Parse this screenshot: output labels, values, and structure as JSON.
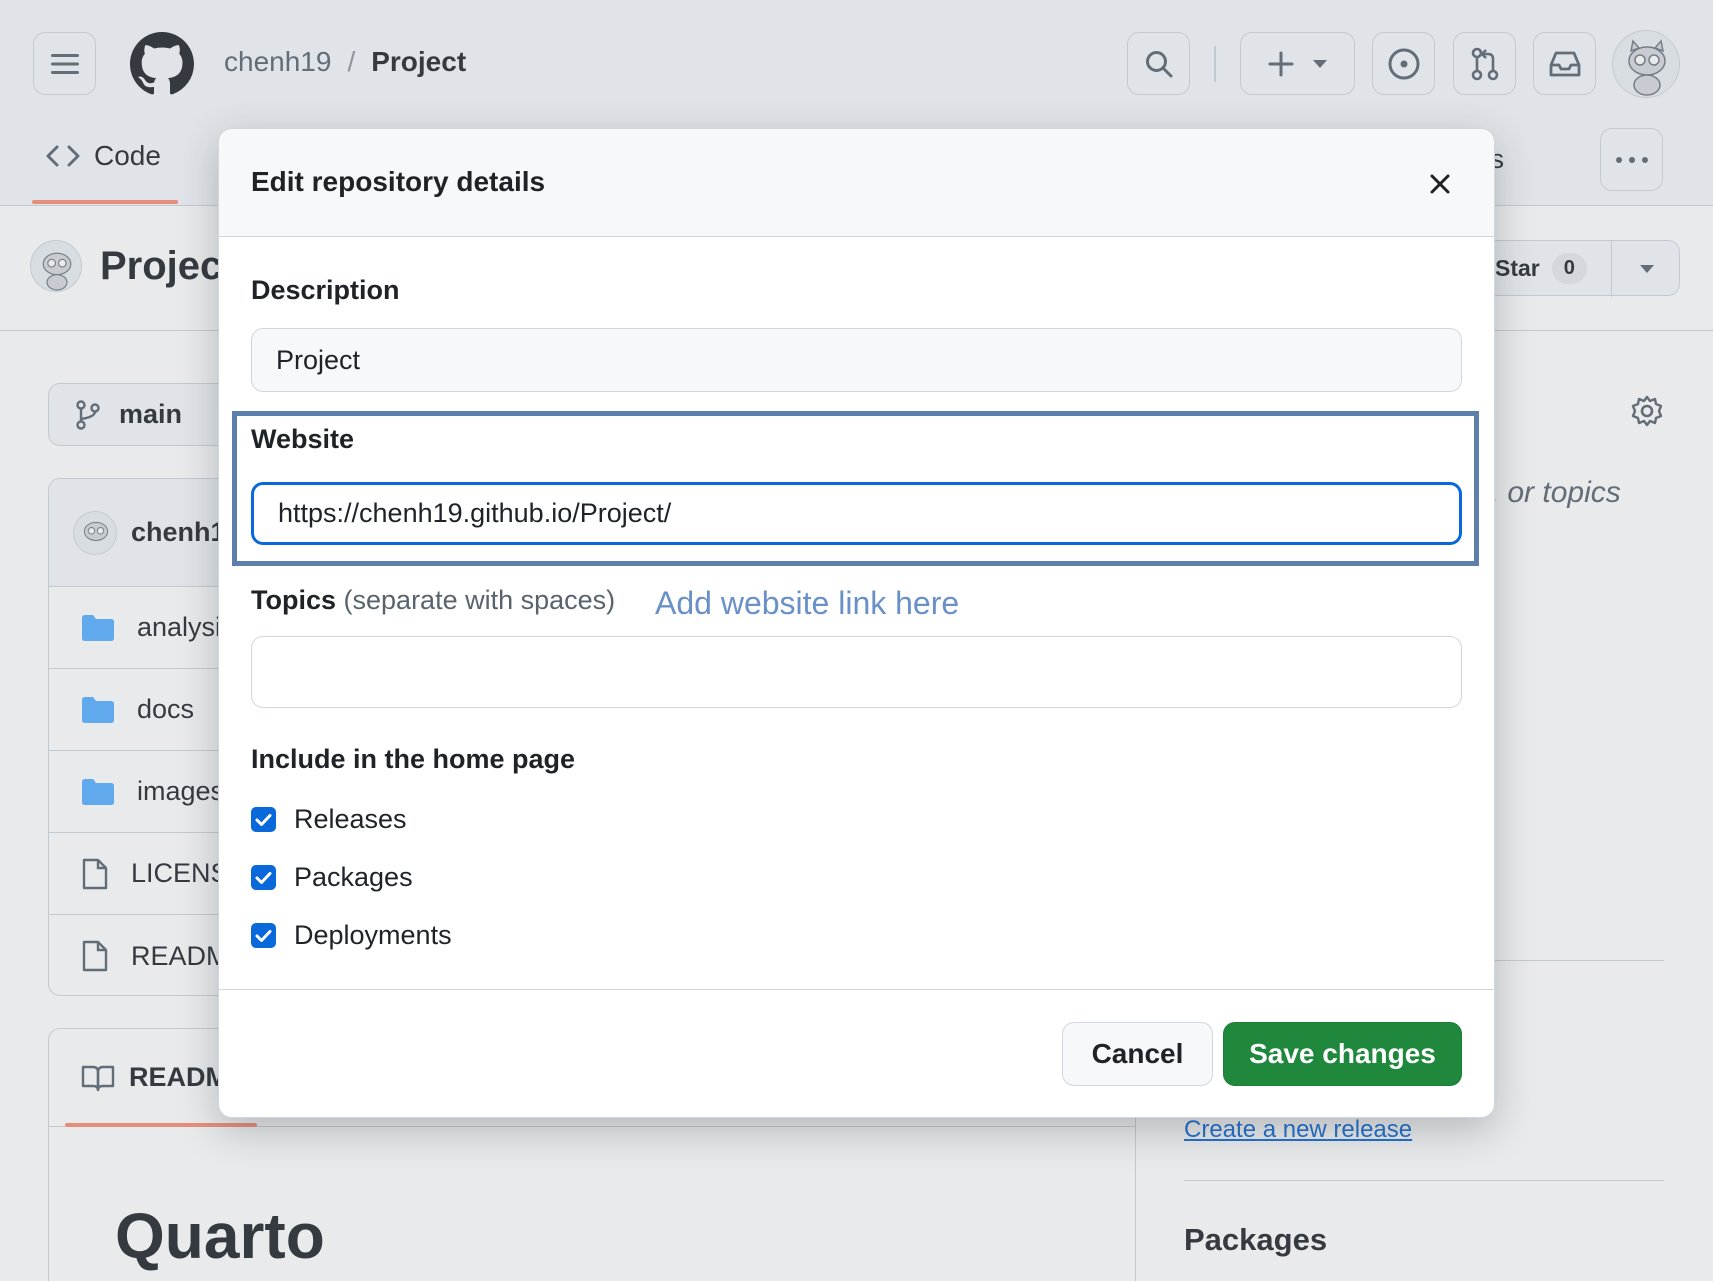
{
  "header": {
    "owner": "chenh19",
    "separator": "/",
    "repo": "Project"
  },
  "tabs": {
    "code": "Code",
    "partial_right": "nts"
  },
  "repo_title": "Project",
  "star": {
    "label": "Star",
    "count": "0"
  },
  "branch": "main",
  "files": {
    "head_user": "chenh1",
    "rows": [
      {
        "name": "analysi",
        "icon": "folder-icon"
      },
      {
        "name": "docs",
        "icon": "folder-icon"
      },
      {
        "name": "images",
        "icon": "folder-icon"
      },
      {
        "name": "LICENS",
        "icon": "file-icon"
      },
      {
        "name": "READM",
        "icon": "file-icon"
      }
    ]
  },
  "readme": {
    "tab_label": "READM",
    "heading": "Quarto"
  },
  "sidebar": {
    "about_placeholder": "e, or topics",
    "create_release": "Create a new release",
    "packages_heading": "Packages"
  },
  "modal": {
    "title": "Edit repository details",
    "description_label": "Description",
    "description_value": "Project",
    "website_label": "Website",
    "website_value": "https://chenh19.github.io/Project/",
    "topics_label": "Topics",
    "topics_hint": "(separate with spaces)",
    "topics_value": "",
    "annotation": "Add website link here",
    "include_heading": "Include in the home page",
    "checkboxes": [
      {
        "label": "Releases",
        "checked": true
      },
      {
        "label": "Packages",
        "checked": true
      },
      {
        "label": "Deployments",
        "checked": true
      }
    ],
    "cancel_label": "Cancel",
    "save_label": "Save changes"
  },
  "colors": {
    "accent": "#0969da",
    "primary_button": "#1f883d",
    "highlight_box": "#5d7fab",
    "annotation_text": "#6a90c8"
  }
}
